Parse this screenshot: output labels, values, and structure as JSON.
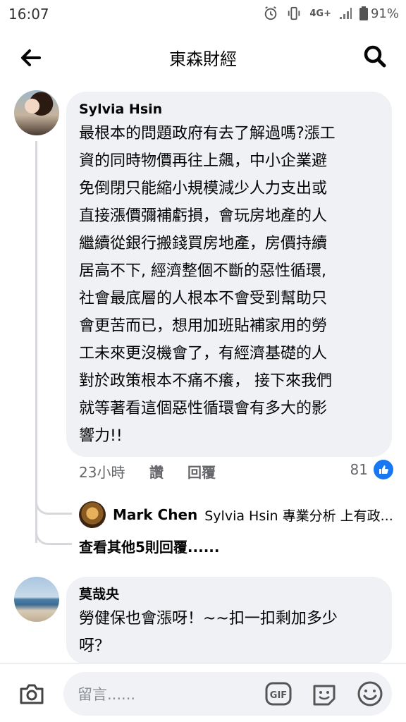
{
  "status_bar": {
    "time": "16:07",
    "network": "4G+",
    "battery": "91%"
  },
  "header": {
    "title": "東森財經"
  },
  "comments": [
    {
      "author": "Sylvia Hsin",
      "text": "最根本的問題政府有去了解過嗎?漲工\n資的同時物價再往上飆，中小企業避\n免倒閉只能縮小規模減少人力支出或\n直接漲價彌補虧損，會玩房地產的人\n繼續從銀行搬錢買房地產，房價持續\n居高不下, 經濟整個不斷的惡性循環,\n社會最底層的人根本不會受到幫助只\n會更苦而已，想用加班貼補家用的勞\n工未來更沒機會了，有經濟基礎的人\n對於政策根本不痛不癢， 接下來我們\n就等著看這個惡性循環會有多大的影\n響力!!",
      "time": "23小時",
      "like_label": "讚",
      "reply_label": "回覆",
      "reaction_count": "81",
      "reply_preview": {
        "author": "Mark Chen",
        "text": "Sylvia Hsin 專業分析 上有政..."
      },
      "more_replies": "查看其他5則回覆......"
    },
    {
      "author": "莫哉央",
      "text": "勞健保也會漲呀！~~扣一扣剩加多少\n呀？"
    }
  ],
  "composer": {
    "placeholder": "留言......",
    "gif_label": "GIF"
  },
  "colors": {
    "bubble": "#eff1f5",
    "like_blue": "#1877f2",
    "meta_gray": "#65676b"
  }
}
